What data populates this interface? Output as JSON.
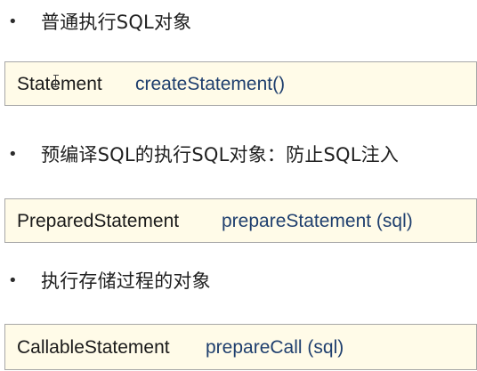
{
  "sections": [
    {
      "bullet": "•",
      "heading": "普通执行SQL对象",
      "class_name": "Statement",
      "method": "createStatement()"
    },
    {
      "bullet": "•",
      "heading": "预编译SQL的执行SQL对象：防止SQL注入",
      "class_name": "PreparedStatement",
      "method": "prepareStatement (sql)"
    },
    {
      "bullet": "•",
      "heading": "执行存储过程的对象",
      "class_name": "CallableStatement",
      "method": "prepareCall (sql)"
    }
  ],
  "colors": {
    "box_background": "#fffbe8",
    "box_border": "#a7a7a7",
    "method_text": "#1f3f6e"
  }
}
